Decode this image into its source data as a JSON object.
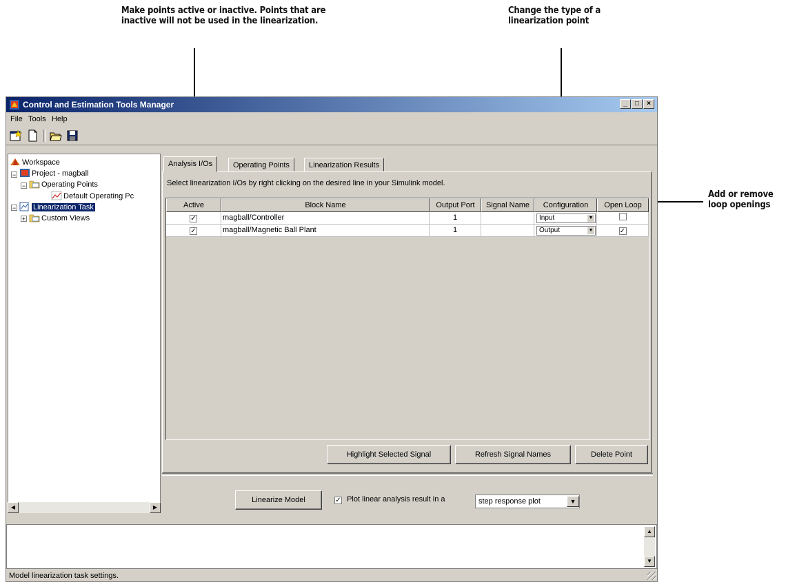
{
  "callouts": {
    "active": [
      "Make points active or inactive. Points that are",
      "inactive will not be used in the linearization."
    ],
    "config": [
      "Change the type of a",
      "linearization point"
    ],
    "openloop": [
      "Add or remove",
      "loop openings"
    ]
  },
  "window": {
    "title": "Control and Estimation Tools Manager",
    "minimize": "_",
    "maximize": "□",
    "close": "×"
  },
  "menu": [
    "File",
    "Tools",
    "Help"
  ],
  "toolbar": [
    "new-project-icon",
    "new-task-icon",
    "open-folder-icon",
    "save-icon"
  ],
  "tree": {
    "workspace": "Workspace",
    "project": "Project - magball",
    "operating_points": "Operating Points",
    "default_op": "Default Operating Pc",
    "linearization_task": "Linearization Task",
    "custom_views": "Custom Views"
  },
  "tabs": [
    "Analysis I/Os",
    "Operating Points",
    "Linearization Results"
  ],
  "instructions": "Select linearization I/Os by right clicking on the desired line in your Simulink model.",
  "table": {
    "headers": [
      "Active",
      "Block Name",
      "Output Port",
      "Signal Name",
      "Configuration",
      "Open Loop"
    ],
    "rows": [
      {
        "active": "✓",
        "block": "magball/Controller",
        "port": "1",
        "signal": "",
        "config": "Input",
        "open_loop": ""
      },
      {
        "active": "✓",
        "block": "magball/Magnetic Ball Plant",
        "port": "1",
        "signal": "",
        "config": "Output",
        "open_loop": "✓"
      }
    ]
  },
  "buttons": {
    "highlight": "Highlight Selected Signal",
    "refresh": "Refresh Signal Names",
    "delete": "Delete Point",
    "linearize": "Linearize Model"
  },
  "plot": {
    "checkbox_mark": "✓",
    "label": "Plot linear analysis result in a",
    "selected": "step response plot"
  },
  "status": "Model linearization task settings."
}
